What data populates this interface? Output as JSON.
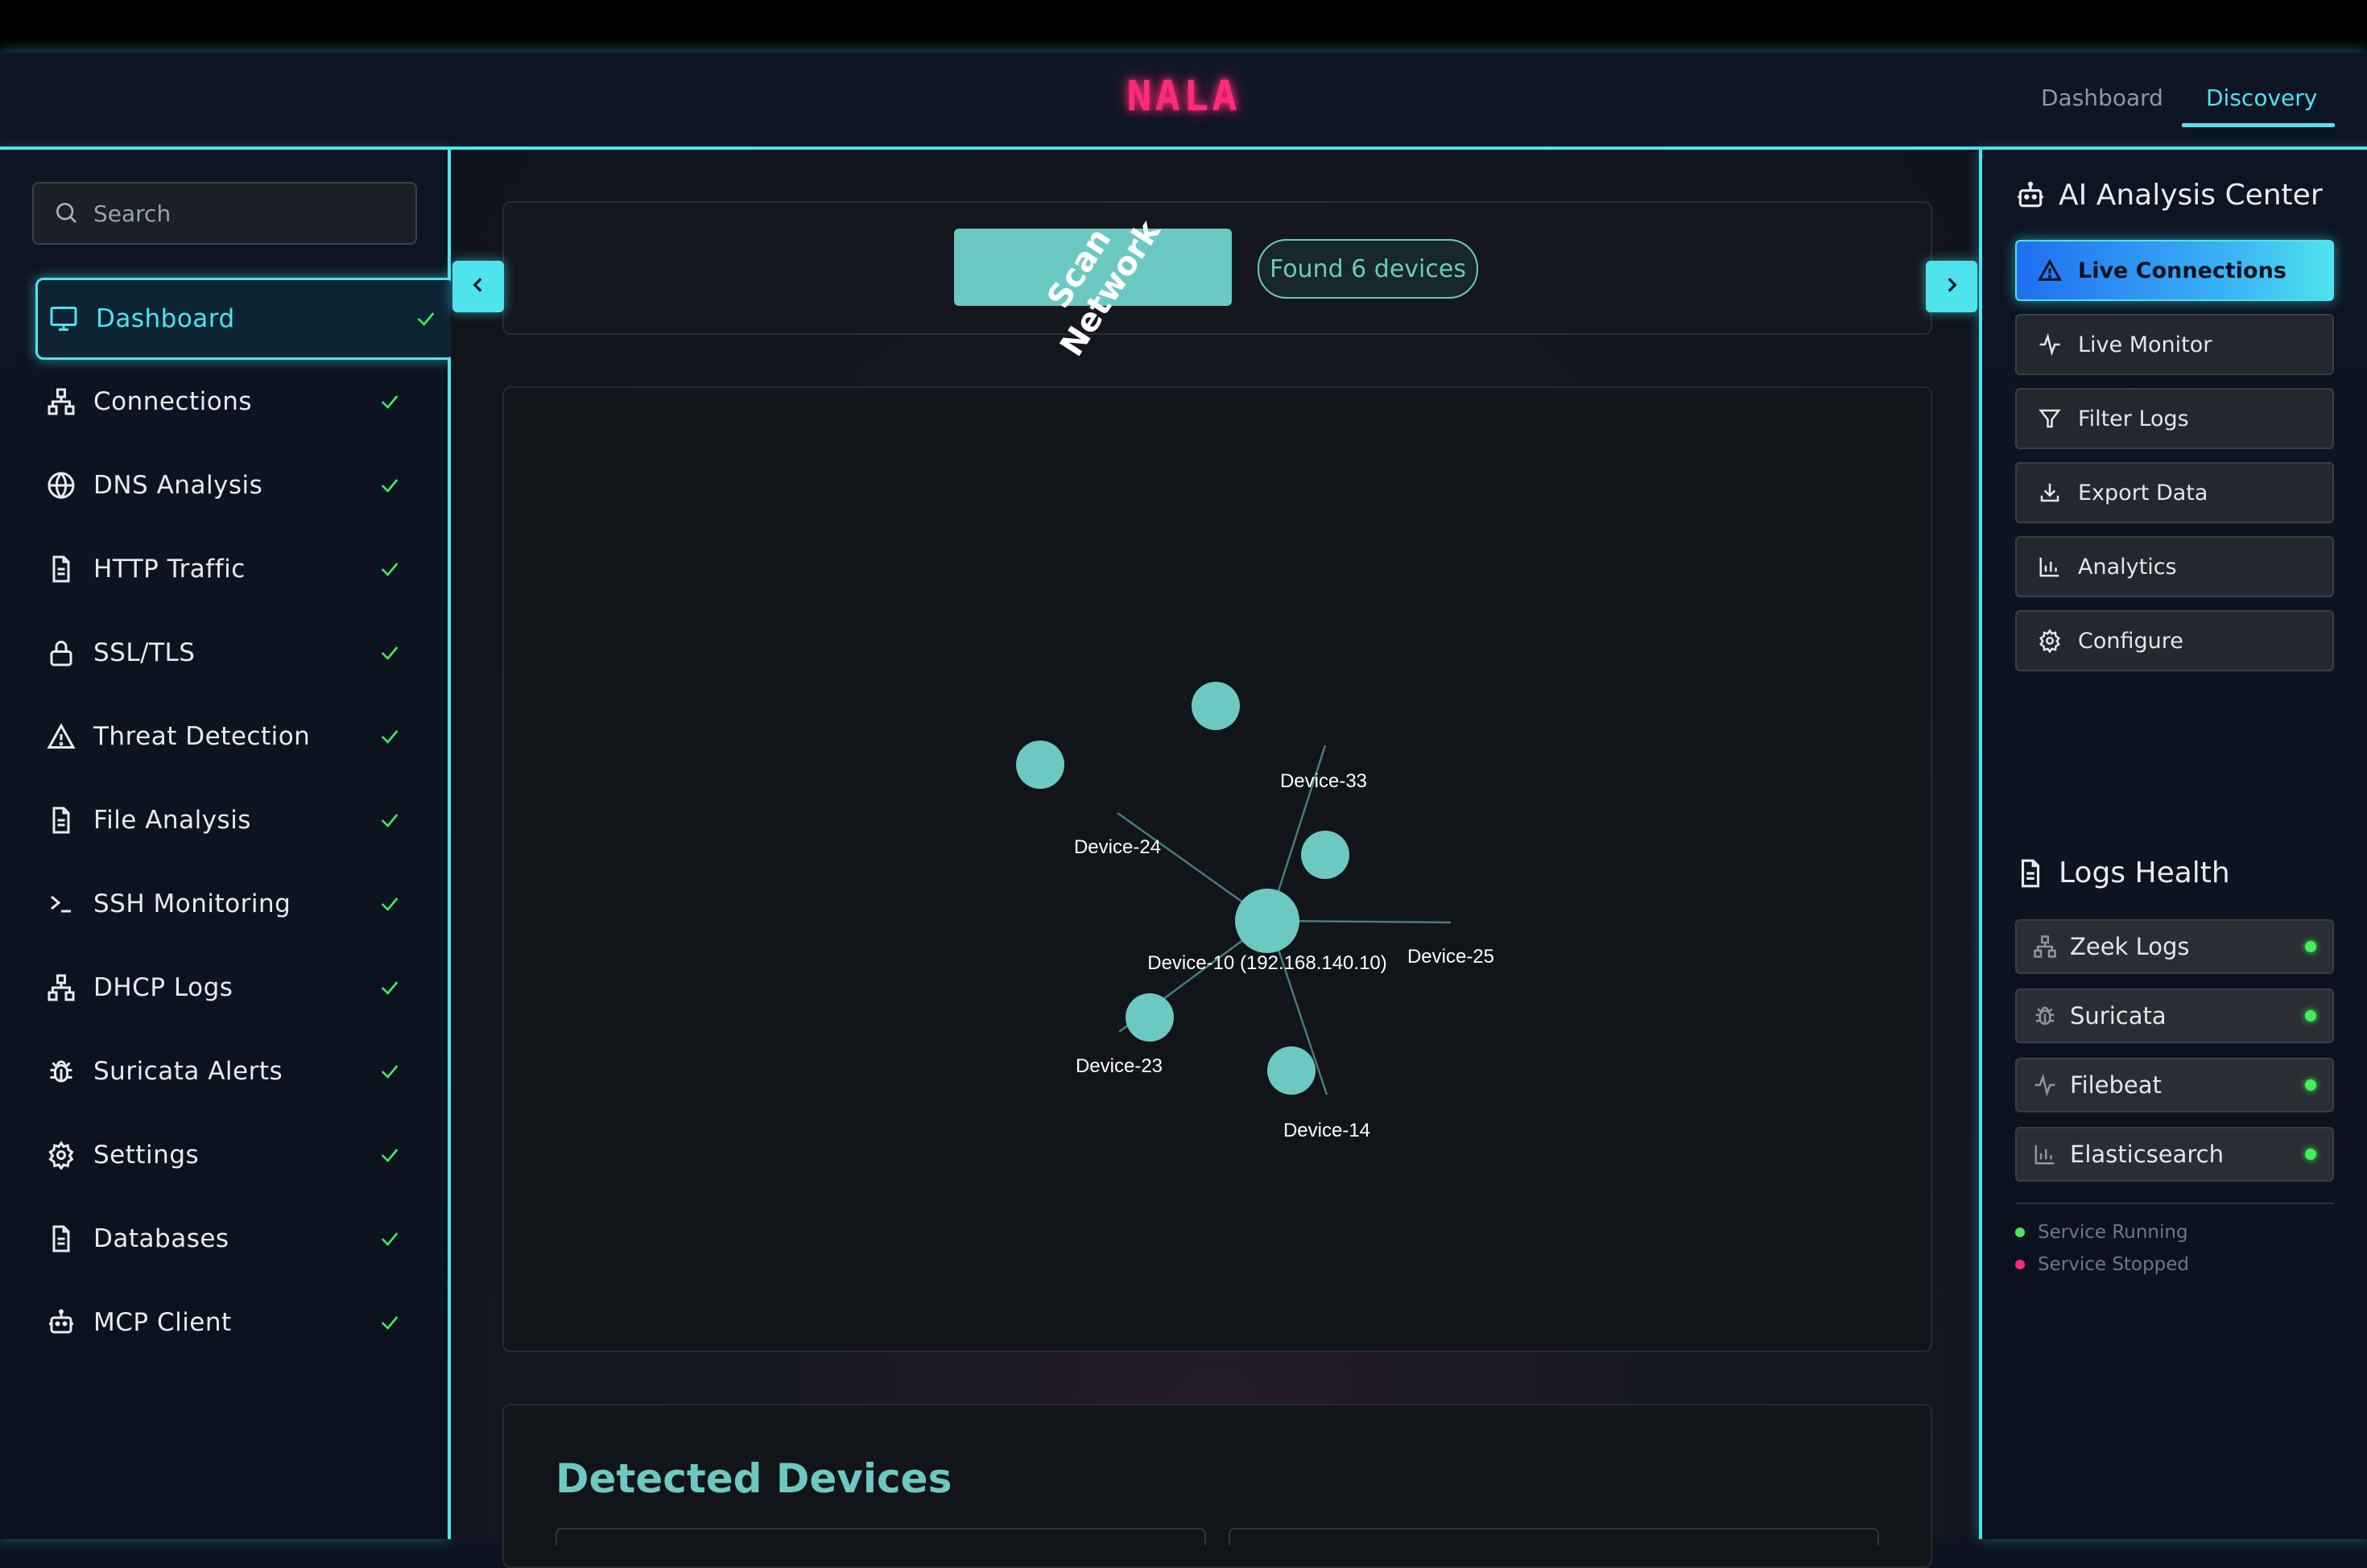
{
  "header": {
    "brand": "NALA",
    "tabs": [
      {
        "label": "Dashboard",
        "active": false
      },
      {
        "label": "Discovery",
        "active": true
      }
    ]
  },
  "sidebar": {
    "search_placeholder": "Search",
    "items": [
      {
        "label": "Dashboard",
        "icon": "monitor-icon",
        "active": true
      },
      {
        "label": "Connections",
        "icon": "network-icon"
      },
      {
        "label": "DNS Analysis",
        "icon": "globe-icon"
      },
      {
        "label": "HTTP Traffic",
        "icon": "document-icon"
      },
      {
        "label": "SSL/TLS",
        "icon": "lock-icon"
      },
      {
        "label": "Threat Detection",
        "icon": "warning-icon"
      },
      {
        "label": "File Analysis",
        "icon": "document-icon"
      },
      {
        "label": "SSH Monitoring",
        "icon": "terminal-icon"
      },
      {
        "label": "DHCP Logs",
        "icon": "network-icon"
      },
      {
        "label": "Suricata Alerts",
        "icon": "bug-icon"
      },
      {
        "label": "Settings",
        "icon": "gear-icon"
      },
      {
        "label": "Databases",
        "icon": "document-icon"
      },
      {
        "label": "MCP Client",
        "icon": "robot-icon"
      }
    ]
  },
  "scan": {
    "button_label": "Scan Network",
    "status": "Found 6 devices"
  },
  "graph": {
    "nodes": [
      {
        "label": "Device-10 (192.168.140.10)",
        "center": true
      },
      {
        "label": "Device-33"
      },
      {
        "label": "Device-24"
      },
      {
        "label": "Device-25"
      },
      {
        "label": "Device-23"
      },
      {
        "label": "Device-14"
      }
    ]
  },
  "devices_section": {
    "title": "Detected Devices"
  },
  "right_panel": {
    "ai_title": "AI Analysis Center",
    "actions": [
      {
        "label": "Live Connections",
        "icon": "warning-icon",
        "active": true
      },
      {
        "label": "Live Monitor",
        "icon": "pulse-icon"
      },
      {
        "label": "Filter Logs",
        "icon": "filter-icon"
      },
      {
        "label": "Export Data",
        "icon": "download-icon"
      },
      {
        "label": "Analytics",
        "icon": "bar-chart-icon"
      },
      {
        "label": "Configure",
        "icon": "gear-icon"
      }
    ],
    "logs_title": "Logs Health",
    "logs": [
      {
        "label": "Zeek Logs",
        "icon": "network-icon",
        "status": "running"
      },
      {
        "label": "Suricata",
        "icon": "bug-icon",
        "status": "running"
      },
      {
        "label": "Filebeat",
        "icon": "pulse-icon",
        "status": "running"
      },
      {
        "label": "Elasticsearch",
        "icon": "bar-chart-icon",
        "status": "running"
      }
    ],
    "legend": [
      {
        "label": "Service Running",
        "color": "#43ee5b"
      },
      {
        "label": "Service Stopped",
        "color": "#ff2a7a"
      }
    ]
  },
  "colors": {
    "accent": "#4fe3ee",
    "brand": "#ff2a7a",
    "teal": "#6cc9c1",
    "status_ok": "#43ee5b"
  }
}
